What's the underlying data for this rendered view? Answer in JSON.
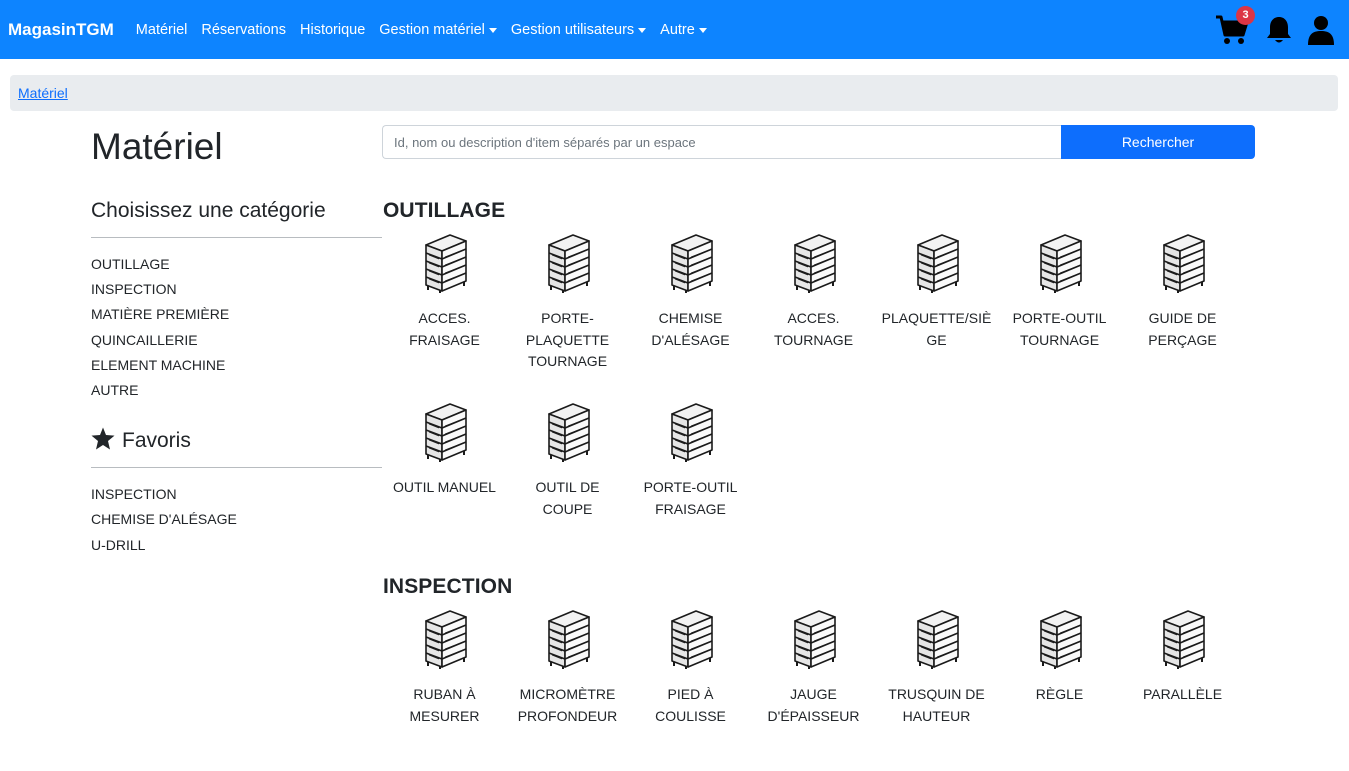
{
  "navbar": {
    "brand": "MagasinTGM",
    "items": [
      {
        "label": "Matériel",
        "dropdown": false
      },
      {
        "label": "Réservations",
        "dropdown": false
      },
      {
        "label": "Historique",
        "dropdown": false
      },
      {
        "label": "Gestion matériel",
        "dropdown": true
      },
      {
        "label": "Gestion utilisateurs",
        "dropdown": true
      },
      {
        "label": "Autre",
        "dropdown": true
      }
    ],
    "cart_count": "3",
    "icons": [
      "cart-icon",
      "bell-icon",
      "user-icon"
    ]
  },
  "breadcrumb": {
    "current": "Matériel"
  },
  "page": {
    "title": "Matériel"
  },
  "search": {
    "placeholder": "Id, nom ou description d'item séparés par un espace",
    "value": "",
    "button": "Rechercher"
  },
  "sidebar": {
    "category_heading": "Choisissez une catégorie",
    "categories": [
      "OUTILLAGE",
      "INSPECTION",
      "MATIÈRE PREMIÈRE",
      "QUINCAILLERIE",
      "ELEMENT MACHINE",
      "AUTRE"
    ],
    "favorites_heading": "Favoris",
    "favorites": [
      "INSPECTION",
      "CHEMISE D'ALÉSAGE",
      "U-DRILL"
    ]
  },
  "sections": [
    {
      "title": "OUTILLAGE",
      "items": [
        "ACCES. FRAISAGE",
        "PORTE-PLAQUETTE TOURNAGE",
        "CHEMISE D'ALÉSAGE",
        "ACCES. TOURNAGE",
        "PLAQUETTE/SIÈGE",
        "PORTE-OUTIL TOURNAGE",
        "GUIDE DE PERÇAGE",
        "OUTIL MANUEL",
        "OUTIL DE COUPE",
        "PORTE-OUTIL FRAISAGE"
      ]
    },
    {
      "title": "INSPECTION",
      "items": [
        "RUBAN À MESURER",
        "MICROMÈTRE PROFONDEUR",
        "PIED À COULISSE",
        "JAUGE D'ÉPAISSEUR",
        "TRUSQUIN DE HAUTEUR",
        "RÈGLE",
        "PARALLÈLE"
      ]
    }
  ],
  "colors": {
    "navbar": "#0d84ff",
    "primary": "#0d6efd",
    "badge": "#dc3545",
    "breadcrumb_bg": "#e9ecef"
  }
}
